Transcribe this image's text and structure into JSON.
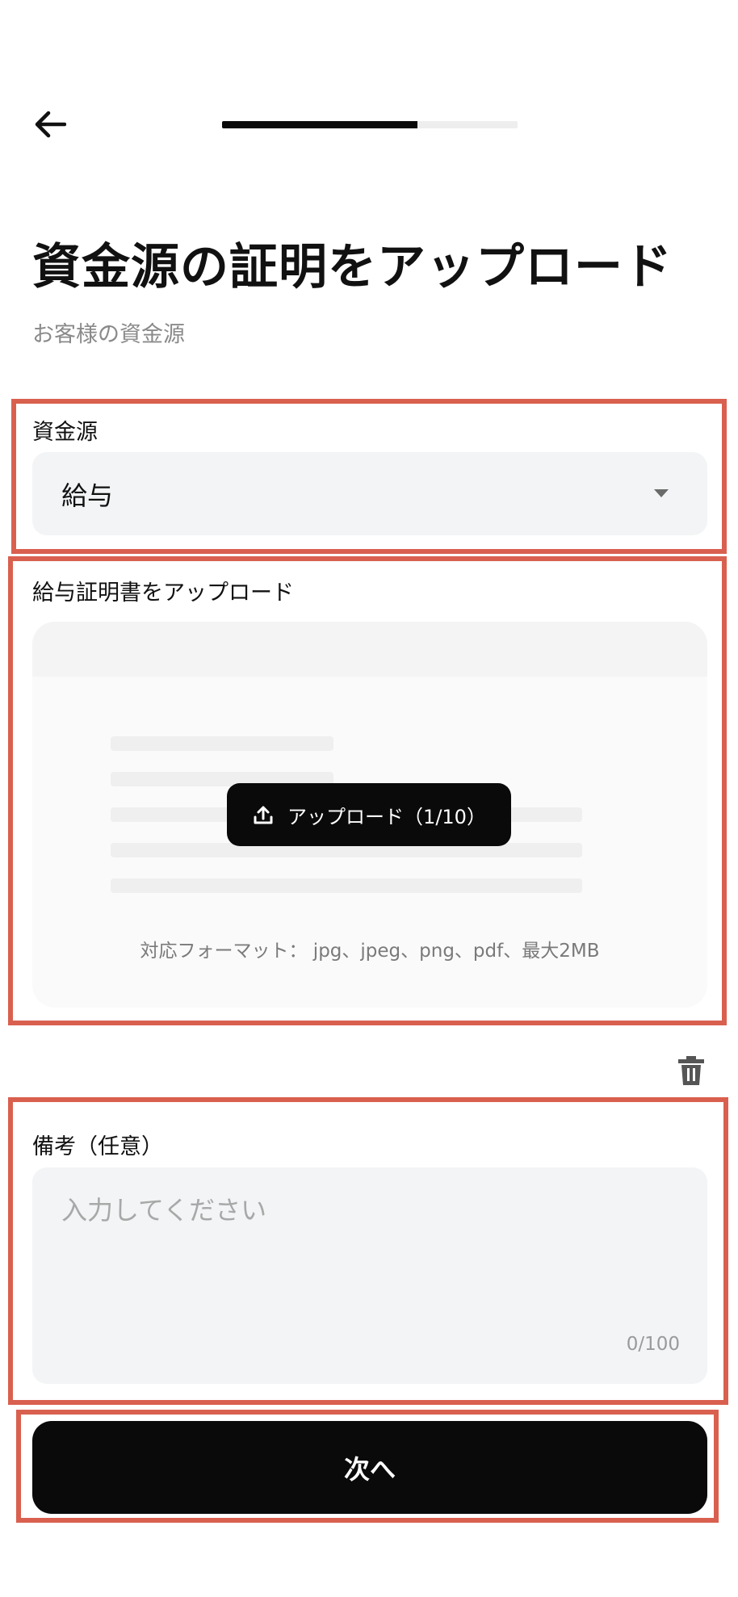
{
  "header": {
    "back_icon": "arrow-left-icon",
    "progress_fraction": 0.66
  },
  "title": "資金源の証明をアップロード",
  "subtitle": "お客様の資金源",
  "fund_source": {
    "label": "資金源",
    "selected": "給与",
    "caret_icon": "chevron-down-icon"
  },
  "upload": {
    "label": "給与証明書をアップロード",
    "button_icon": "upload-icon",
    "button_label": "アップロード（1/10）",
    "formats": "対応フォーマット：  jpg、jpeg、png、pdf、最大2MB"
  },
  "delete_icon": "trash-icon",
  "remarks": {
    "label": "備考（任意）",
    "placeholder": "入力してください",
    "value": "",
    "counter": "0/100"
  },
  "next_button": "次へ",
  "colors": {
    "highlight": "#d9604f",
    "primary": "#0a0a0a",
    "field_bg": "#f2f4f5"
  }
}
